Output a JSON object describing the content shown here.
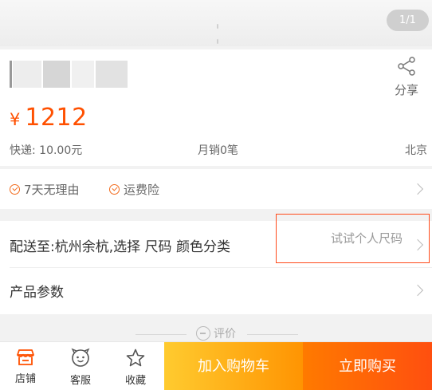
{
  "gallery": {
    "counter": "1/1"
  },
  "product": {
    "share_label": "分享",
    "currency": "¥",
    "price": "1212",
    "shipping_fee": "快递: 10.00元",
    "monthly_sales": "月销0笔",
    "location": "北京"
  },
  "services": [
    {
      "label": "7天无理由"
    },
    {
      "label": "运费险"
    }
  ],
  "options": {
    "delivery_select": "配送至:杭州余杭,选择  尺码 颜色分类",
    "try_size": "试试个人尺码",
    "params": "产品参数"
  },
  "review_divider": "评价",
  "bottom_bar": {
    "shop": "店铺",
    "service": "客服",
    "favorite": "收藏",
    "add_to_cart": "加入购物车",
    "buy_now": "立即购买"
  },
  "colors": {
    "accent": "#ff5000",
    "cart_gradient": [
      "#ffcb2f",
      "#ff9402"
    ],
    "buy_gradient": [
      "#ff7a00",
      "#ff4f0f"
    ],
    "highlight_box": "#ff4a1a"
  }
}
